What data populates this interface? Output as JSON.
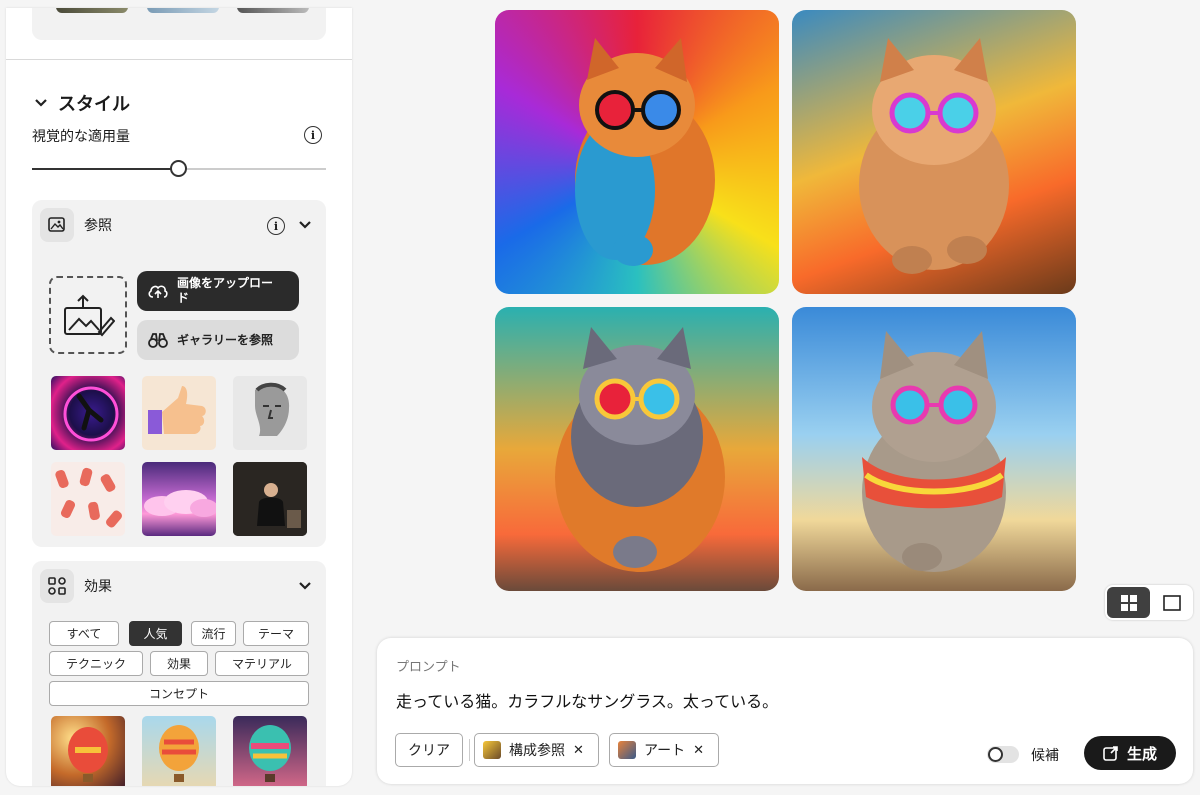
{
  "sidebar": {
    "style": {
      "title": "スタイル",
      "visual_intensity_label": "視覚的な適用量",
      "visual_intensity_level": 0.5
    },
    "reference": {
      "title": "参照",
      "upload_button": "画像をアップロード",
      "gallery_button": "ギャラリーを参照"
    },
    "effects": {
      "title": "効果",
      "chips": [
        "すべて",
        "人気",
        "流行",
        "テーマ",
        "テクニック",
        "効果",
        "マテリアル",
        "コンセプト"
      ],
      "active_chip": "人気"
    }
  },
  "prompt": {
    "label": "プロンプト",
    "text": "走っている猫。カラフルなサングラス。太っている。",
    "clear_button": "クリア",
    "tags": [
      {
        "label": "構成参照"
      },
      {
        "label": "アート"
      }
    ],
    "toggle_label": "候補",
    "generate_button": "生成"
  },
  "colors": {
    "dark": "#2b2b2b",
    "panel": "#f2f2f2",
    "accent_gen": "#1a1a1a"
  }
}
